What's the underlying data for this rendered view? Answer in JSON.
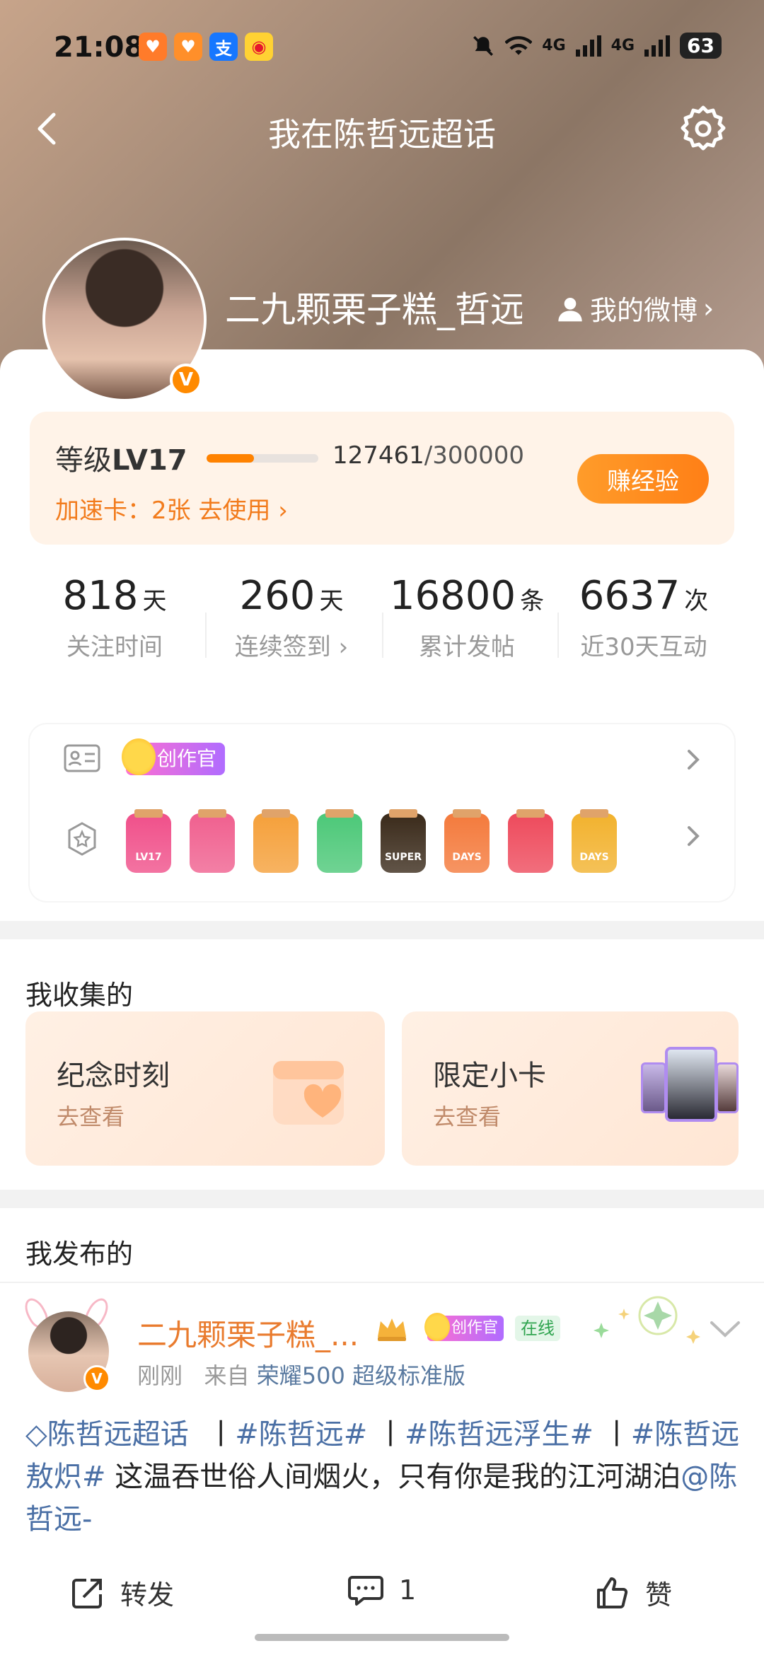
{
  "status_bar": {
    "time": "21:08",
    "battery": "63",
    "network_1": "4G",
    "network_2": "4G"
  },
  "nav": {
    "title": "我在陈哲远超话"
  },
  "profile": {
    "username": "二九颗栗子糕_哲远",
    "badge": "V",
    "my_weibo": "我的微博"
  },
  "level": {
    "label": "等级",
    "level": "LV17",
    "progress_current": "127461",
    "progress_total": "/300000",
    "progress_fraction": 0.425,
    "speed_card": "加速卡：2张 去使用",
    "earn_button": "赚经验"
  },
  "stats": [
    {
      "value": "818",
      "unit": "天",
      "label": "关注时间"
    },
    {
      "value": "260",
      "unit": "天",
      "label": "连续签到 ›"
    },
    {
      "value": "16800",
      "unit": "条",
      "label": "累计发帖"
    },
    {
      "value": "6637",
      "unit": "次",
      "label": "近30天互动"
    }
  ],
  "honors": {
    "creator_badge": "创作官",
    "medals": [
      {
        "text": "LV17",
        "color": "#f0508a"
      },
      {
        "text": "",
        "color": "#f0608f"
      },
      {
        "text": "",
        "color": "#f5a03a"
      },
      {
        "text": "",
        "color": "#4cc878"
      },
      {
        "text": "SUPER",
        "color": "#3a2a1a"
      },
      {
        "text": "DAYS",
        "color": "#f47a3c"
      },
      {
        "text": "",
        "color": "#ee4a5c"
      },
      {
        "text": "DAYS",
        "color": "#f2b22e"
      }
    ]
  },
  "collect": {
    "title": "我收集的",
    "cards": [
      {
        "name": "纪念时刻",
        "sub": "去查看"
      },
      {
        "name": "限定小卡",
        "sub": "去查看"
      }
    ]
  },
  "posts": {
    "title": "我发布的",
    "item": {
      "author": "二九颗栗子糕_...",
      "creator_badge": "创作官",
      "online": "在线",
      "badge": "V",
      "time": "刚刚",
      "from": "来自",
      "device": "荣耀500 超级标准版",
      "tag1": "陈哲远超话",
      "sep": "丨",
      "tag2": "#陈哲远#",
      "tag3": "#陈哲远浮生#",
      "tag4": "#陈哲远敖炽#",
      "text": " 这温吞世俗人间烟火，只有你是我的江河湖泊",
      "mention": "@陈哲远-",
      "repost_label": "转发",
      "comment_count": "1",
      "like_label": "赞"
    }
  }
}
